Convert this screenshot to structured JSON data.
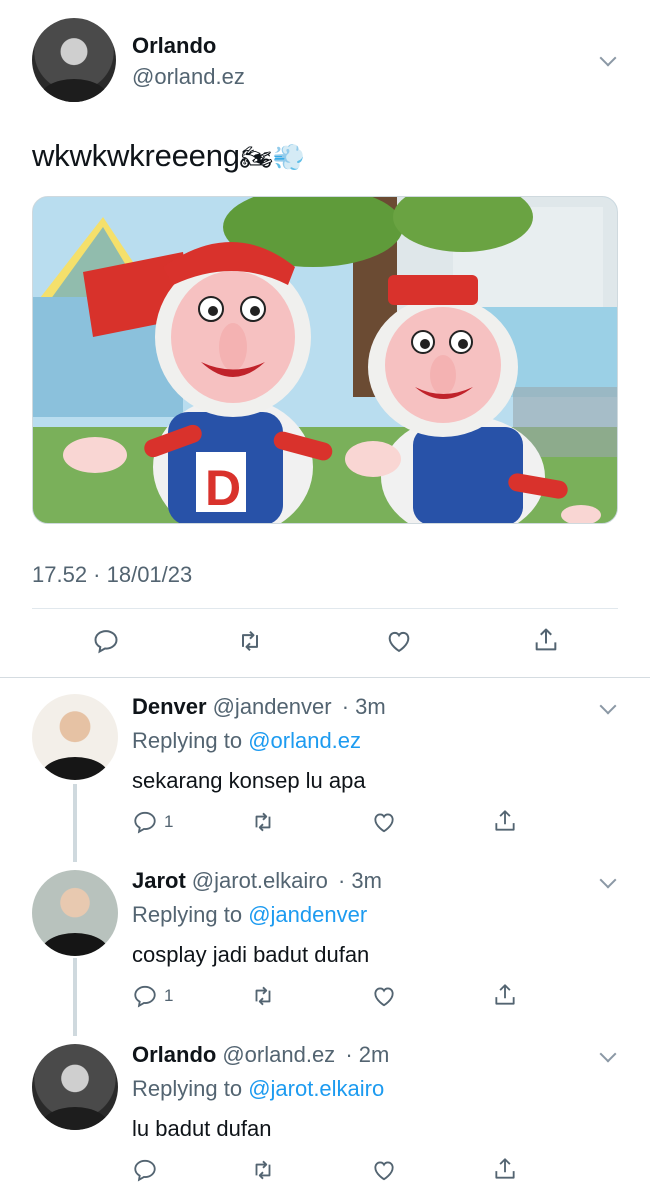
{
  "main": {
    "name": "Orlando",
    "handle": "@orland.ez",
    "text": "wkwkwkreeeng",
    "emoji": "🏍💨",
    "timestamp": "17.52 · 18/01/23",
    "media_icons": [
      "reply-icon",
      "retweet-icon",
      "like-icon",
      "share-icon"
    ]
  },
  "replies": [
    {
      "name": "Denver",
      "handle": "@jandenver",
      "time": "· 3m",
      "replying_prefix": "Replying to ",
      "replying_to": "@orland.ez",
      "text": "sekarang konsep lu apa",
      "reply_count": "1"
    },
    {
      "name": "Jarot",
      "handle": "@jarot.elkairo",
      "time": "· 3m",
      "replying_prefix": "Replying to ",
      "replying_to": "@jandenver",
      "text": "cosplay jadi badut dufan",
      "reply_count": "1"
    },
    {
      "name": "Orlando",
      "handle": "@orland.ez",
      "time": "· 2m",
      "replying_prefix": "Replying to ",
      "replying_to": "@jarot.elkairo",
      "text": "lu badut dufan",
      "reply_count": ""
    }
  ],
  "colors": {
    "link": "#1d9bf0",
    "secondary_text": "#536471",
    "primary_text": "#0f1419"
  }
}
